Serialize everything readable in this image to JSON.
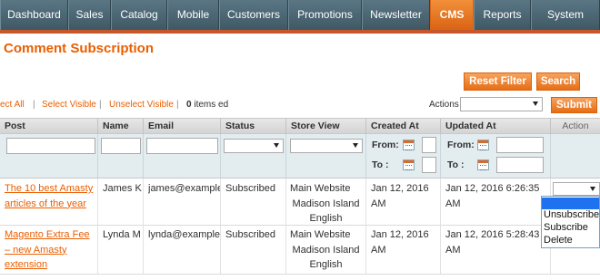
{
  "nav": {
    "items": [
      {
        "label": "Dashboard",
        "active": false
      },
      {
        "label": "Sales",
        "active": false
      },
      {
        "label": "Catalog",
        "active": false
      },
      {
        "label": "Mobile",
        "active": false
      },
      {
        "label": "Customers",
        "active": false
      },
      {
        "label": "Promotions",
        "active": false
      },
      {
        "label": "Newsletter",
        "active": false
      },
      {
        "label": "CMS",
        "active": true
      },
      {
        "label": "Reports",
        "active": false
      },
      {
        "label": "System",
        "active": false
      }
    ]
  },
  "page": {
    "title": "Comment Subscription"
  },
  "buttons": {
    "reset_filter": "Reset Filter",
    "search": "Search",
    "submit": "Submit"
  },
  "massaction": {
    "select_all": "ect All",
    "select_visible": "Select Visible",
    "unselect_visible": "Unselect Visible",
    "sep": "|",
    "count_number": "0",
    "count_suffix": " items ed",
    "actions_label": "Actions",
    "actions_value": ""
  },
  "grid": {
    "columns": [
      "Post",
      "Name",
      "Email",
      "Status",
      "Store View",
      "Created At",
      "Updated At",
      "Action"
    ],
    "filters": {
      "from_label": "From:",
      "to_label": "To :"
    },
    "rows": [
      {
        "post": "The 10 best Amasty articles of the year",
        "name": "James K",
        "email": "james@example",
        "status": "Subscribed",
        "store": [
          "Main Website",
          "Madison Island",
          "English"
        ],
        "created": "Jan 12, 2016 AM",
        "updated": "Jan 12, 2016 6:26:35 AM"
      },
      {
        "post": "Magento Extra Fee – new Amasty extension",
        "name": "Lynda M",
        "email": "lynda@example.",
        "status": "Subscribed",
        "store": [
          "Main Website",
          "Madison Island",
          "English"
        ],
        "created": "Jan 12, 2016 AM",
        "updated": "Jan 12, 2016 5:28:43 AM"
      }
    ],
    "row_action_options": [
      "",
      "Unsubscribe",
      "Subscribe",
      "Delete"
    ],
    "row_action_highlighted": ""
  },
  "colors": {
    "accent": "#eb5e00",
    "nav_bg": "#4a6573",
    "nav_active": "#e8761f",
    "filter_bg": "#e3edf0"
  }
}
